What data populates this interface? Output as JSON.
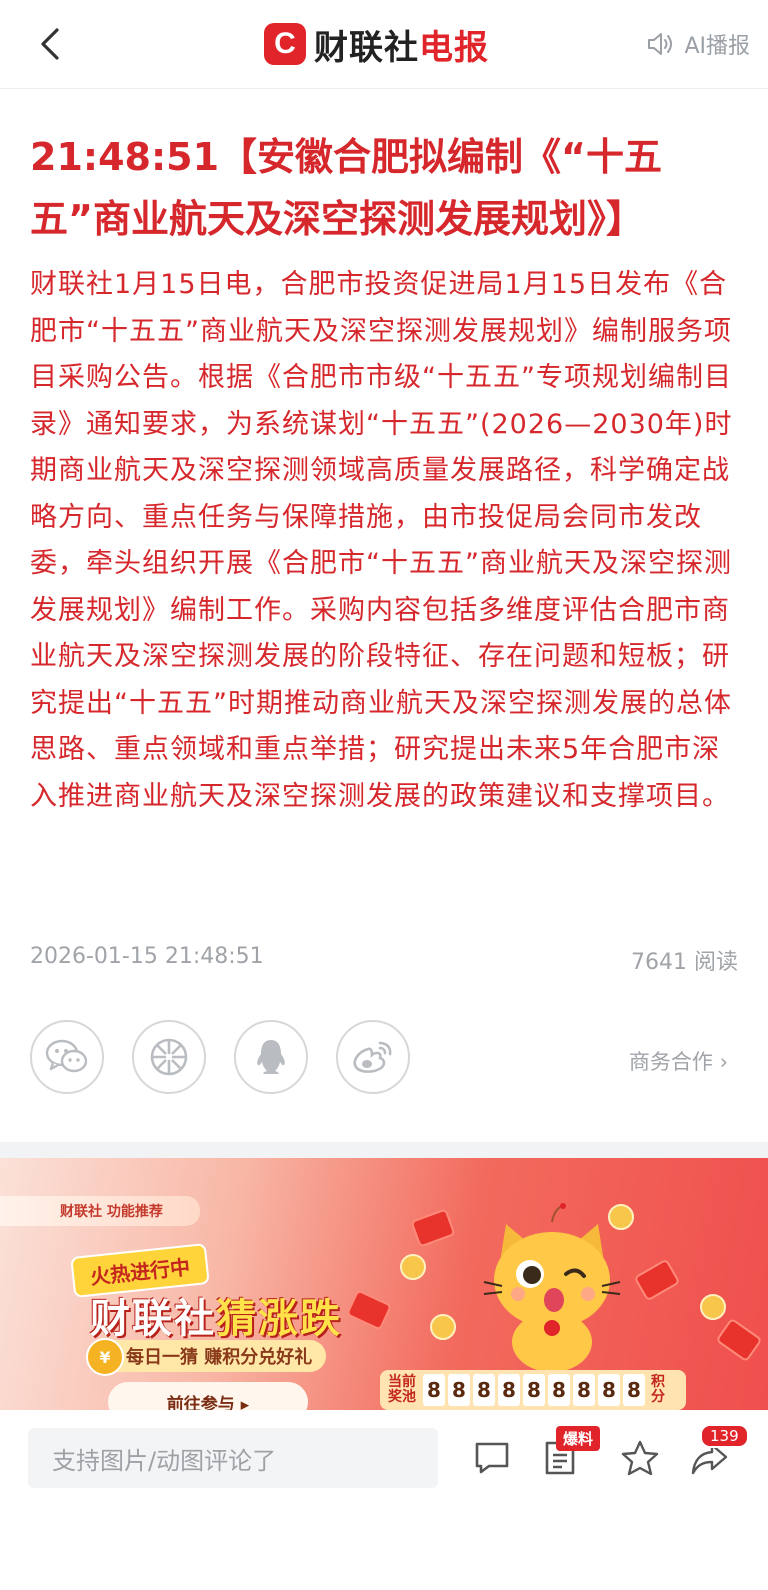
{
  "header": {
    "brand_letter": "C",
    "brand_name_black": "财联社",
    "brand_name_red": "电报",
    "ai_play_label": "AI播报",
    "icons": [
      "chevron-left-icon",
      "speaker-icon"
    ]
  },
  "article": {
    "title": "21:48:51【安徽合肥拟编制《“十五五”商业航天及深空探测发展规划》】",
    "body": "财联社1月15日电，合肥市投资促进局1月15日发布《合肥市“十五五”商业航天及深空探测发展规划》编制服务项目采购公告。根据《合肥市市级“十五五”专项规划编制目录》通知要求，为系统谋划“十五五”(2026—2030年)时期商业航天及深空探测领域高质量发展路径，科学确定战略方向、重点任务与保障措施，由市投促局会同市发改委，牵头组织开展《合肥市“十五五”商业航天及深空探测发展规划》编制工作。采购内容包括多维度评估合肥市商业航天及深空探测发展的阶段特征、存在问题和短板；研究提出“十五五”时期推动商业航天及深空探测发展的总体思路、重点领域和重点举措；研究提出未来5年合肥市深入推进商业航天及深空探测发展的政策建议和支撑项目。",
    "timestamp": "2026-01-15 21:48:51",
    "read_count": "7641 阅读"
  },
  "share": {
    "items": [
      "wechat-icon",
      "moments-icon",
      "qq-icon",
      "weibo-icon"
    ],
    "business_link": "商务合作 ›"
  },
  "banner": {
    "tag": "财联社 功能推荐",
    "hot_badge": "火热进行中",
    "main_title_white": "财联社",
    "main_title_yellow": "猜涨跌",
    "subtitle": "每日一猜 赚积分兑好礼",
    "cta": "前往参与 ▸",
    "pool_label_line1": "当前",
    "pool_label_line2": "奖池",
    "pool_digits": [
      "8",
      "8",
      "8",
      "8",
      "8",
      "8",
      "8",
      "8",
      "8"
    ],
    "pool_unit_line1": "积",
    "pool_unit_line2": "分"
  },
  "bottom_bar": {
    "comment_placeholder": "支持图片/动图评论了",
    "report_badge": "爆料",
    "share_count": "139",
    "icons": [
      "comment-icon",
      "report-icon",
      "star-icon",
      "share-icon"
    ]
  },
  "colors": {
    "brand_red": "#e0242a",
    "article_red": "#d6282c",
    "meta_gray": "#a0a4a8"
  }
}
